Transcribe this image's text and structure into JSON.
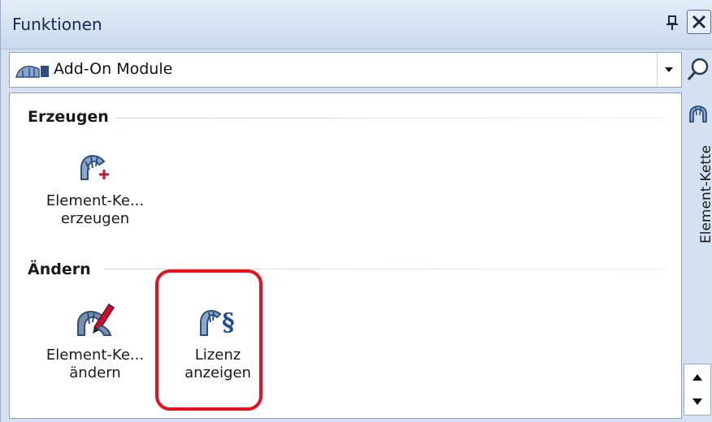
{
  "panel": {
    "title": "Funktionen",
    "pin_icon": "pin-icon",
    "close_icon": "close-icon"
  },
  "combo": {
    "selected": "Add-On Module",
    "icon": "module-icon",
    "dropdown_icon": "dropdown-arrow-icon",
    "search_icon": "search-icon"
  },
  "groups": [
    {
      "header": "Erzeugen",
      "tools": [
        {
          "line1": "Element-Ke...",
          "line2": "erzeugen",
          "icon": "element-chain-create-icon"
        }
      ]
    },
    {
      "header": "Ändern",
      "tools": [
        {
          "line1": "Element-Ke...",
          "line2": "ändern",
          "icon": "element-chain-modify-icon"
        },
        {
          "line1": "Lizenz",
          "line2": "anzeigen",
          "icon": "license-show-icon"
        }
      ]
    }
  ],
  "side_tab": {
    "label": "Element-Kette",
    "icon": "element-chain-icon"
  },
  "scroll": {
    "up_icon": "scroll-up-icon",
    "down_icon": "scroll-down-icon"
  },
  "colors": {
    "panel_bg": "#d5e1f1",
    "highlight": "#e8101c",
    "icon_blue": "#2c4f80"
  }
}
